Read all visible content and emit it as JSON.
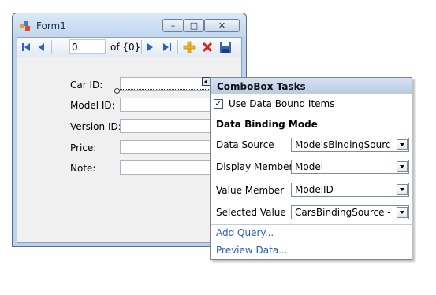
{
  "window": {
    "title": "Form1",
    "caption_buttons": {
      "minimize": "–",
      "maximize": "□",
      "close": "✕"
    }
  },
  "navigator": {
    "position_value": "0",
    "count_label": "of {0}",
    "icons": [
      "move-first-icon",
      "move-previous-icon",
      "move-next-icon",
      "move-last-icon",
      "add-new-icon",
      "delete-icon",
      "save-icon"
    ]
  },
  "fields": [
    {
      "label": "Car ID:",
      "kind": "textbox"
    },
    {
      "label": "Model ID:",
      "kind": "combobox"
    },
    {
      "label": "Version ID:",
      "kind": "combobox"
    },
    {
      "label": "Price:",
      "kind": "textbox"
    },
    {
      "label": "Note:",
      "kind": "textbox"
    }
  ],
  "tasks": {
    "header": "ComboBox Tasks",
    "use_data_bound": {
      "label": "Use Data Bound Items",
      "checked": true
    },
    "section_heading": "Data Binding Mode",
    "properties": [
      {
        "label": "Data Source",
        "value": "ModelsBindingSource"
      },
      {
        "label": "Display Member",
        "value": "Model"
      },
      {
        "label": "Value Member",
        "value": "ModelID"
      },
      {
        "label": "Selected Value",
        "value": "CarsBindingSource - Mo"
      }
    ],
    "links": {
      "add_query": "Add Query...",
      "preview_data": "Preview Data..."
    }
  },
  "colors": {
    "window_frame": "#bcd2ec",
    "client_bg": "#f0f0f0",
    "link": "#2a5db0",
    "delete_red": "#e0201b",
    "add_gold": "#f0b21a",
    "nav_blue": "#2a62c9"
  }
}
